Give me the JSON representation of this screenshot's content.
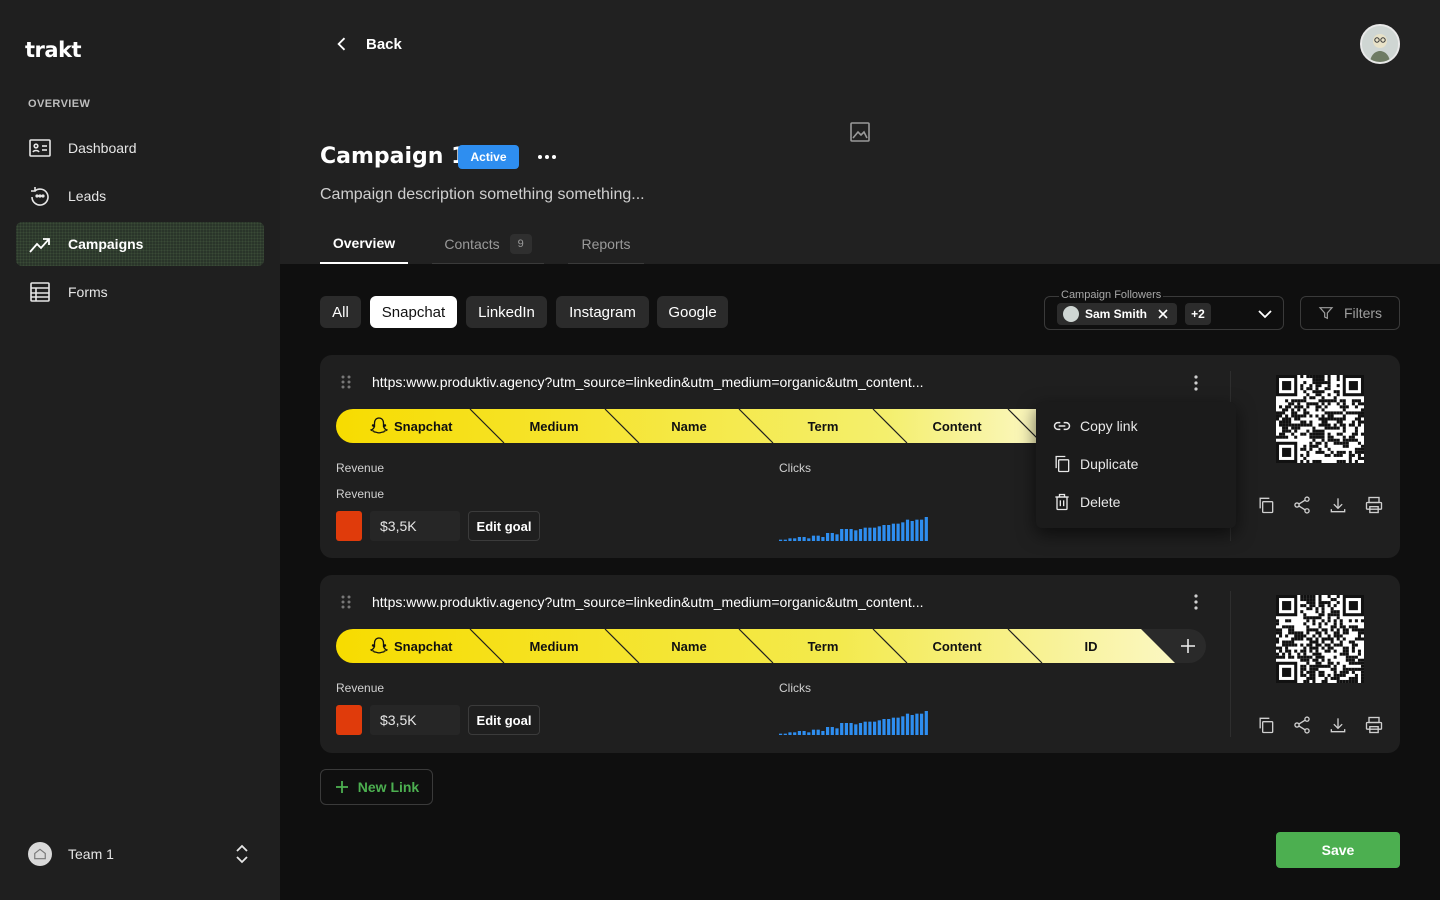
{
  "app": {
    "logo": "trakt"
  },
  "sidebar": {
    "section": "OVERVIEW",
    "items": [
      {
        "label": "Dashboard",
        "icon": "dashboard-icon"
      },
      {
        "label": "Leads",
        "icon": "leads-icon"
      },
      {
        "label": "Campaigns",
        "icon": "trending-up-icon",
        "active": true
      },
      {
        "label": "Forms",
        "icon": "table-icon"
      }
    ],
    "team": "Team 1"
  },
  "header": {
    "back": "Back",
    "title": "Campaign 1",
    "status": "Active",
    "description": "Campaign description something something...",
    "tabs": [
      {
        "label": "Overview",
        "active": true
      },
      {
        "label": "Contacts",
        "count": "9"
      },
      {
        "label": "Reports"
      }
    ]
  },
  "filters": {
    "channels": [
      "All",
      "Snapchat",
      "LinkedIn",
      "Instagram",
      "Google"
    ],
    "selected": "Snapchat",
    "followers_label": "Campaign Followers",
    "follower": "Sam Smith",
    "more_followers": "+2",
    "filters_button": "Filters"
  },
  "links": [
    {
      "url": "https:www.produktiv.agency?utm_source=linkedin&utm_medium=organic&utm_content...",
      "segments": [
        "Snapchat",
        "Medium",
        "Name",
        "Term",
        "Content"
      ],
      "revenue_label": "Revenue",
      "revenue_sublabel": "Revenue",
      "revenue_value": "$3,5K",
      "edit_goal": "Edit goal",
      "clicks_label": "Clicks",
      "clicks": [
        1,
        1,
        2,
        2,
        3,
        3,
        2,
        4,
        4,
        3,
        6,
        6,
        5,
        9,
        9,
        9,
        8,
        9,
        10,
        10,
        10,
        11,
        12,
        12,
        13,
        13,
        14,
        16,
        15,
        16,
        16,
        18
      ]
    },
    {
      "url": "https:www.produktiv.agency?utm_source=linkedin&utm_medium=organic&utm_content...",
      "segments": [
        "Snapchat",
        "Medium",
        "Name",
        "Term",
        "Content",
        "ID"
      ],
      "revenue_label": "Revenue",
      "revenue_value": "$3,5K",
      "edit_goal": "Edit goal",
      "clicks_label": "Clicks",
      "clicks": [
        1,
        1,
        2,
        2,
        3,
        3,
        2,
        4,
        4,
        3,
        6,
        6,
        5,
        9,
        9,
        9,
        8,
        9,
        10,
        10,
        10,
        11,
        12,
        12,
        13,
        13,
        14,
        16,
        15,
        16,
        16,
        18
      ]
    }
  ],
  "context_menu": {
    "items": [
      {
        "label": "Copy link",
        "icon": "link-icon"
      },
      {
        "label": "Duplicate",
        "icon": "duplicate-icon"
      },
      {
        "label": "Delete",
        "icon": "trash-icon"
      }
    ]
  },
  "footer": {
    "new_link": "New Link",
    "save": "Save"
  },
  "colors": {
    "accent_green": "#4caf50",
    "active_badge": "#2e8ef0",
    "revenue_swatch": "#e03b0b",
    "spark_bar": "#2e8ef0",
    "utm_yellow_start": "#f5dd00",
    "utm_yellow_end": "#fbf7c2"
  }
}
